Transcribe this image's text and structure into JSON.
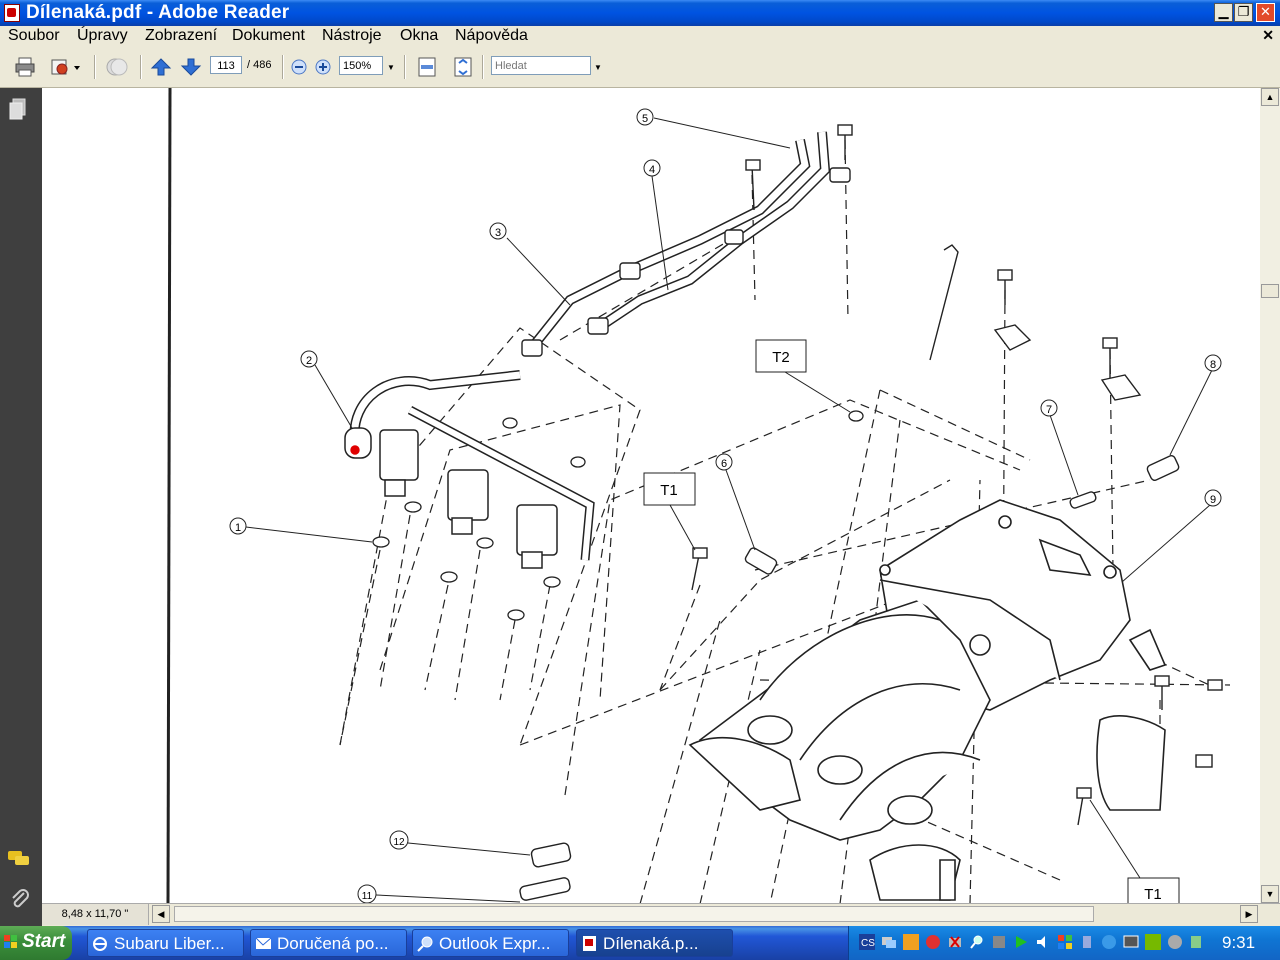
{
  "window": {
    "title": "Dílenaká.pdf - Adobe Reader"
  },
  "menu": {
    "items": [
      "Soubor",
      "Úpravy",
      "Zobrazení",
      "Dokument",
      "Nástroje",
      "Okna",
      "Nápověda"
    ]
  },
  "toolbar": {
    "page_current": "113",
    "page_total": "/ 486",
    "zoom": "150%",
    "search_placeholder": "Hledat"
  },
  "status": {
    "page_size": "8,48 x 11,70 \""
  },
  "diagram": {
    "callouts": [
      "1",
      "2",
      "3",
      "4",
      "5",
      "6",
      "7",
      "8",
      "9",
      "11",
      "12"
    ],
    "torque_labels": [
      "T1",
      "T2"
    ]
  },
  "taskbar": {
    "start_label": "Start",
    "tasks": [
      "Subaru Liber...",
      "Doručená po...",
      "Outlook Expr...",
      "Dílenaká.p..."
    ],
    "clock": "9:31"
  },
  "colors": {
    "titlebar": "#0053e1",
    "taskbar": "#2157d7",
    "start": "#3c8f3c",
    "nav": "#3f3f3f"
  }
}
